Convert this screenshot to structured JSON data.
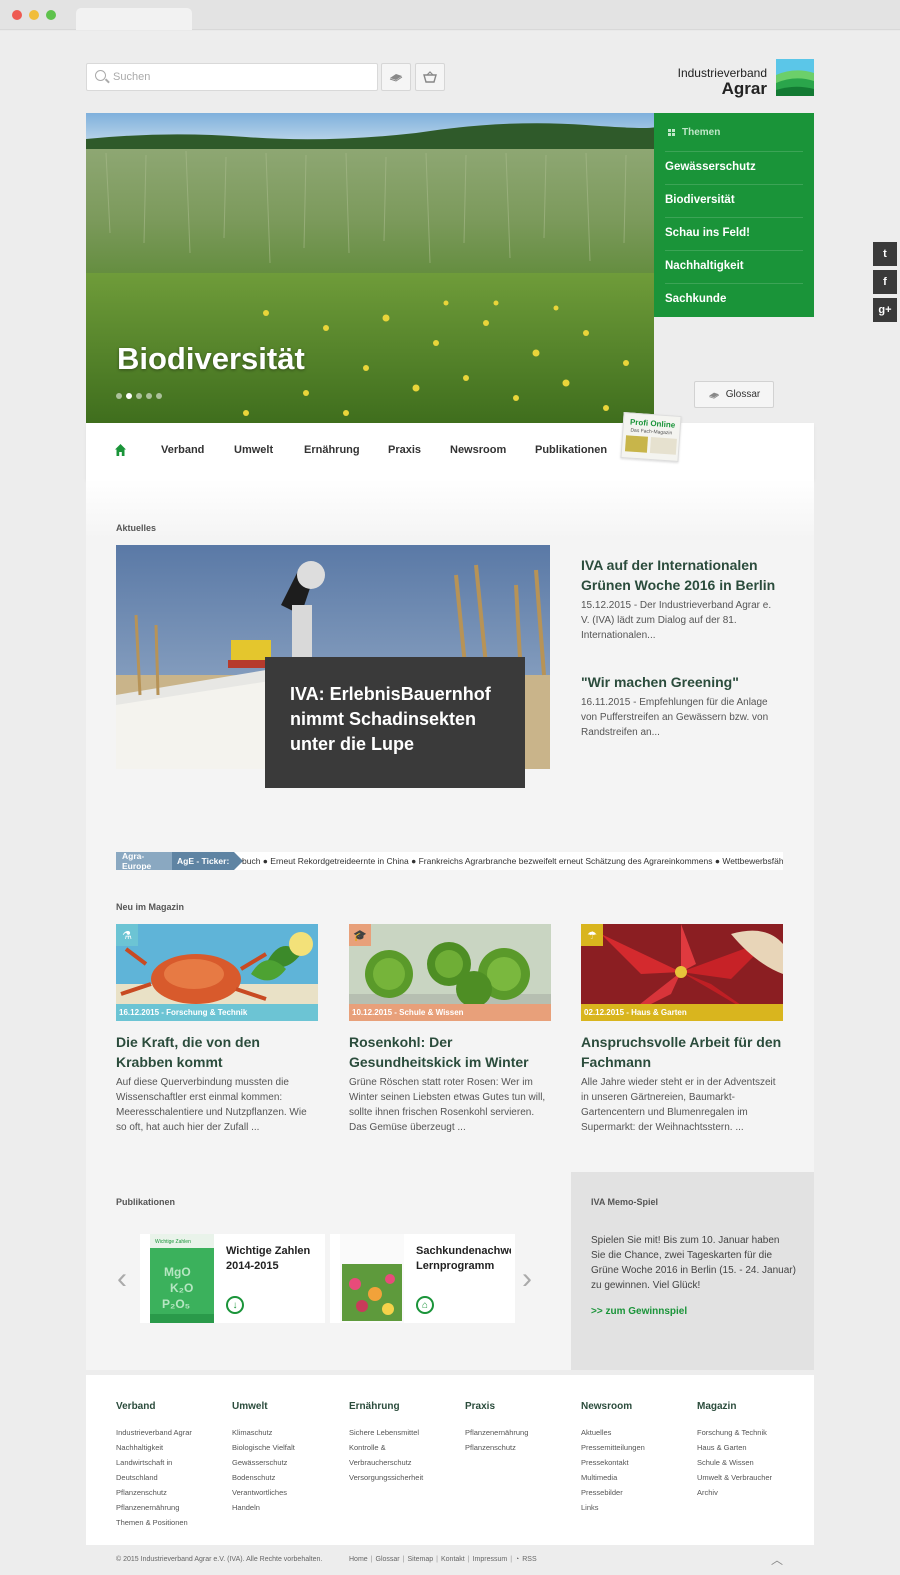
{
  "header": {
    "search_placeholder": "Suchen",
    "logo_line1": "Industrieverband",
    "logo_line2": "Agrar"
  },
  "hero": {
    "title": "Biodiversität",
    "slides": 5,
    "active_slide": 2
  },
  "themen": {
    "heading": "Themen",
    "items": [
      "Gewässerschutz",
      "Biodiversität",
      "Schau ins Feld!",
      "Nachhaltigkeit",
      "Sachkunde"
    ]
  },
  "glossar_label": "Glossar",
  "nav": {
    "items": [
      "Verband",
      "Umwelt",
      "Ernährung",
      "Praxis",
      "Newsroom",
      "Publikationen"
    ],
    "profi_title": "Profi Online",
    "profi_sub": "Das Fach-Magazin"
  },
  "aktuelles": {
    "label": "Aktuelles",
    "featured_title": "IVA: ErlebnisBauernhof nimmt Schadinsekten unter die Lupe",
    "items": [
      {
        "title": "IVA auf der Internationalen Grünen Woche 2016 in Berlin",
        "text": "15.12.2015 - Der Industrieverband Agrar e. V. (IVA) lädt zum Dialog auf der 81. Internationalen..."
      },
      {
        "title": "\"Wir machen Greening\"",
        "text": "16.11.2015 - Empfehlungen für die Anlage von Pufferstreifen an Gewässern bzw. von Randstreifen an..."
      }
    ]
  },
  "ticker": {
    "label1": "Agra-Europe",
    "label2": "AgE - Ticker:",
    "text": "buch ● Erneut Rekordgetreideernte in China ● Frankreichs Agrarbranche bezweifelt erneut Schätzung des Agrareinkommens ● Wettbewerbsfähigkeit"
  },
  "magazin": {
    "label": "Neu im Magazin",
    "cards": [
      {
        "date": "16.12.2015 - Forschung & Technik",
        "title": "Die Kraft, die von den Krabben kommt",
        "text": "Auf diese Querverbindung mussten die Wissenschaftler erst einmal kommen: Meeresschalentiere und Nutzpflanzen. Wie so oft, hat auch hier der Zufall ...",
        "color": "#6cc4d4",
        "icon": "microscope-icon"
      },
      {
        "date": "10.12.2015 - Schule & Wissen",
        "title": "Rosenkohl: Der Gesundheitskick im Winter",
        "text": "Grüne Röschen statt roter Rosen: Wer im Winter seinen Liebsten etwas Gutes tun will, sollte ihnen frischen Rosenkohl servieren. Das Gemüse überzeugt ...",
        "color": "#e8a07a",
        "icon": "graduation-cap-icon"
      },
      {
        "date": "02.12.2015 - Haus & Garten",
        "title": "Anspruchsvolle Arbeit für den Fachmann",
        "text": "Alle Jahre wieder steht er in der Adventszeit in unseren Gärtnereien, Baumarkt-Gartencentern und Blumenregalen im Supermarkt: der Weihnachtsstern. ...",
        "color": "#d9b51e",
        "icon": "watering-can-icon"
      }
    ]
  },
  "publikationen": {
    "label": "Publikationen",
    "items": [
      {
        "title": "Wichtige Zahlen 2014-2015",
        "title_l1": "Wichtige Zahlen",
        "title_l2": "2014-2015",
        "action": "download-icon"
      },
      {
        "title": "Sachkundenachweis Lernprogramm",
        "title_l1": "Sachkundenachweis",
        "title_l2": "Lernprogramm",
        "action": "cart-icon"
      }
    ]
  },
  "memo": {
    "label": "IVA Memo-Spiel",
    "text": "Spielen Sie mit! Bis zum 10. Januar haben Sie die Chance, zwei Tageskarten für die Grüne Woche 2016 in Berlin (15. - 24. Januar) zu gewinnen. Viel Glück!",
    "link": ">> zum Gewinnspiel"
  },
  "footer": {
    "columns": [
      {
        "heading": "Verband",
        "links": [
          "Industrieverband Agrar",
          "Nachhaltigkeit",
          "Landwirtschaft in",
          "Deutschland",
          "Pflanzenschutz",
          "Pflanzenernährung",
          "Themen & Positionen"
        ]
      },
      {
        "heading": "Umwelt",
        "links": [
          "Klimaschutz",
          "Biologische Vielfalt",
          "Gewässerschutz",
          "Bodenschutz",
          "Verantwortliches",
          "Handeln"
        ]
      },
      {
        "heading": "Ernährung",
        "links": [
          "Sichere Lebensmittel",
          "Kontrolle &",
          "Verbraucherschutz",
          "Versorgungssicherheit"
        ]
      },
      {
        "heading": "Praxis",
        "links": [
          "Pflanzenernährung",
          "Pflanzenschutz"
        ]
      },
      {
        "heading": "Newsroom",
        "links": [
          "Aktuelles",
          "Pressemitteilungen",
          "Pressekontakt",
          "Multimedia",
          "Pressebilder",
          "Links"
        ]
      },
      {
        "heading": "Magazin",
        "links": [
          "Forschung & Technik",
          "Haus & Garten",
          "Schule & Wissen",
          "Umwelt & Verbraucher",
          "Archiv"
        ]
      }
    ],
    "copyright": "© 2015 Industrieverband Agrar e.V. (IVA). Alle Rechte vorbehalten.",
    "links": [
      "Home",
      "Glossar",
      "Sitemap",
      "Kontakt",
      "Impressum",
      "RSS"
    ]
  },
  "colors": {
    "brand_green": "#1a9439",
    "title_green": "#2b4c3c",
    "overlay_dark": "#3a3a3a"
  }
}
